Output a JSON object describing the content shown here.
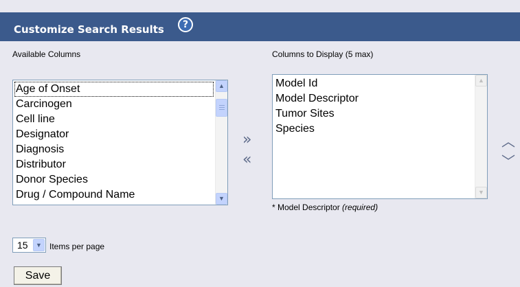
{
  "header": {
    "title": "Customize Search Results",
    "help_glyph": "?"
  },
  "available": {
    "label": "Available Columns",
    "items": [
      "Age of Onset",
      "Carcinogen",
      "Cell line",
      "Designator",
      "Diagnosis",
      "Distributor",
      "Donor Species",
      "Drug / Compound Name"
    ]
  },
  "display": {
    "label": "Columns to Display (5 max)",
    "items": [
      "Model Id",
      "Model Descriptor",
      "Tumor Sites",
      "Species"
    ],
    "note_prefix": "* Model Descriptor",
    "note_required": "(required)"
  },
  "controls": {
    "add_glyph": "»",
    "remove_glyph": "«",
    "move_up_glyph": "︿",
    "move_down_glyph": "﹀"
  },
  "paging": {
    "per_page_value": "15",
    "per_page_label": "Items per page"
  },
  "save_label": "Save",
  "colors": {
    "header_bg": "#3b5a8c",
    "page_bg": "#e8e8f0"
  },
  "icons": {
    "help": "help-icon",
    "add": "add-right-icon",
    "remove": "remove-left-icon",
    "up": "move-up-icon",
    "down": "move-down-icon"
  }
}
